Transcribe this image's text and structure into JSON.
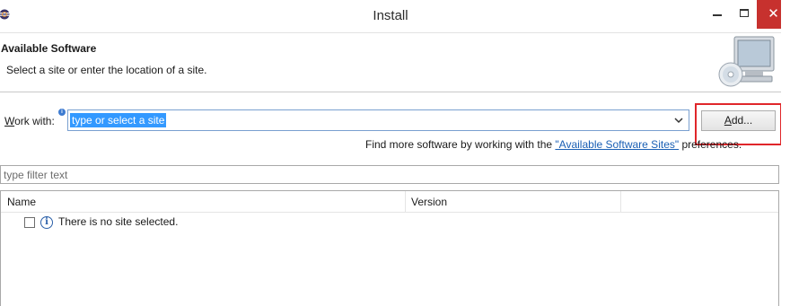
{
  "window": {
    "title": "Install",
    "app_icon": "eclipse-icon",
    "minimize_icon": "minimize-icon",
    "maximize_icon": "maximize-icon",
    "close_icon": "close-icon",
    "close_glyph": "✕",
    "close_color": "#c7312e"
  },
  "header": {
    "title": "Available Software",
    "description": "Select a site or enter the location of a site.",
    "graphic_icon": "monitor-cd-icon"
  },
  "work_with": {
    "label_mnemonic": "W",
    "label_rest": "ork with:",
    "value": "type or select a site",
    "selection_color": "#3399ff",
    "add_button_mnemonic": "A",
    "add_button_rest": "dd...",
    "highlight_color": "#e0262a"
  },
  "find_more": {
    "prefix": "Find more software by working with the ",
    "link": "\"Available Software Sites\"",
    "suffix": " preferences."
  },
  "filter": {
    "placeholder": "type filter text"
  },
  "table": {
    "columns": [
      "Name",
      "Version"
    ],
    "rows": [
      {
        "checked": false,
        "icon": "info-icon",
        "text": "There is no site selected."
      }
    ]
  }
}
